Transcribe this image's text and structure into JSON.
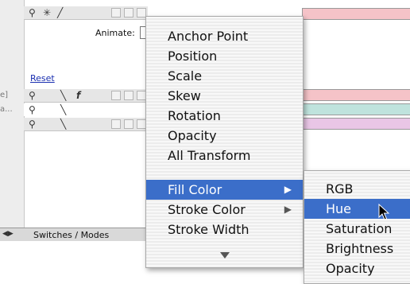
{
  "panel": {
    "animate_label": "Animate:",
    "reset_link": "Reset",
    "left_fragments": [
      "e]",
      "a..."
    ],
    "status_bar_label": "Switches / Modes",
    "fx_glyph": "f"
  },
  "colors": {
    "pink_bar": "#f5c3c8",
    "teal_bar": "#bfe3dd",
    "lilac_bar": "#e9c6e6",
    "menu_highlight": "#3b6ec9"
  },
  "main_menu": {
    "items": [
      {
        "label": "Anchor Point"
      },
      {
        "label": "Position"
      },
      {
        "label": "Scale"
      },
      {
        "label": "Skew"
      },
      {
        "label": "Rotation"
      },
      {
        "label": "Opacity"
      },
      {
        "label": "All Transform"
      },
      {
        "label": "Fill Color",
        "selected": true,
        "submenu": true
      },
      {
        "label": "Stroke Color",
        "submenu": true
      },
      {
        "label": "Stroke Width"
      }
    ],
    "more_indicator": "down-arrow-icon"
  },
  "sub_menu": {
    "items": [
      {
        "label": "RGB"
      },
      {
        "label": "Hue",
        "selected": true
      },
      {
        "label": "Saturation"
      },
      {
        "label": "Brightness"
      },
      {
        "label": "Opacity"
      }
    ]
  }
}
